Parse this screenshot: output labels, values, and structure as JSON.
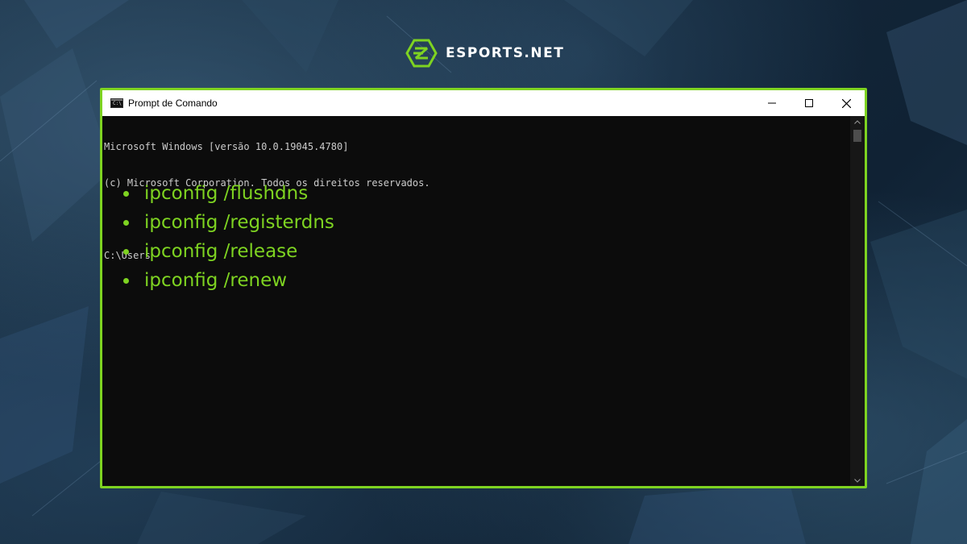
{
  "brand": {
    "name": "ESPORTS.NET",
    "accent_color": "#7ed321",
    "logo_icon": "esports-net-logo-icon"
  },
  "window": {
    "title": "Prompt de Comando",
    "app_icon": "cmd-icon",
    "app_icon_text": "C:\\",
    "controls": [
      "minimize-icon",
      "maximize-icon",
      "close-icon"
    ]
  },
  "console": {
    "lines": [
      "Microsoft Windows [versão 10.0.19045.4780]",
      "(c) Microsoft Corporation. Todos os direitos reservados.",
      "",
      "C:\\Users"
    ]
  },
  "commands": [
    "ipconfig /flushdns",
    "ipconfig /registerdns",
    "ipconfig /release",
    "ipconfig /renew"
  ]
}
